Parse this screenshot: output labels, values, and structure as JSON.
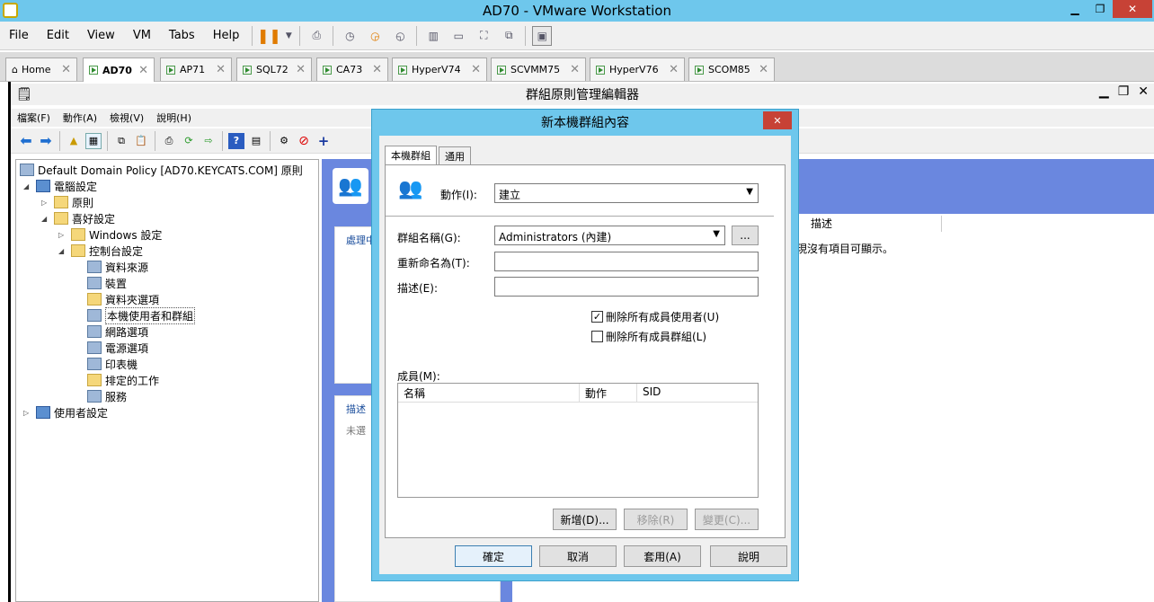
{
  "vmware": {
    "title": "AD70 - VMware Workstation",
    "menu": [
      "File",
      "Edit",
      "View",
      "VM",
      "Tabs",
      "Help"
    ],
    "tabs": [
      {
        "label": "Home",
        "active": false
      },
      {
        "label": "AD70",
        "active": true
      },
      {
        "label": "AP71",
        "active": false
      },
      {
        "label": "SQL72",
        "active": false
      },
      {
        "label": "CA73",
        "active": false
      },
      {
        "label": "HyperV74",
        "active": false
      },
      {
        "label": "SCVMM75",
        "active": false
      },
      {
        "label": "HyperV76",
        "active": false
      },
      {
        "label": "SCOM85",
        "active": false
      }
    ]
  },
  "gpme": {
    "title": "群組原則管理編輯器",
    "menu": [
      "檔案(F)",
      "動作(A)",
      "檢視(V)",
      "說明(H)"
    ],
    "tree": {
      "root": "Default Domain Policy [AD70.KEYCATS.COM] 原則",
      "computer": "電腦設定",
      "policies": "原則",
      "preferences": "喜好設定",
      "windows_settings": "Windows 設定",
      "control_panel": "控制台設定",
      "items": [
        "資料來源",
        "裝置",
        "資料夾選項",
        "本機使用者和群組",
        "網路選項",
        "電源選項",
        "印表機",
        "排定的工作",
        "服務"
      ],
      "user": "使用者設定"
    },
    "right": {
      "col_desc": "描述",
      "empty_text": "現沒有項目可顯示。",
      "tab_process": "處理中",
      "tab_desc": "描述",
      "unselected": "未選"
    }
  },
  "dialog": {
    "title": "新本機群組內容",
    "tabs": [
      "本機群組",
      "通用"
    ],
    "action_label": "動作(I):",
    "action_value": "建立",
    "group_label": "群組名稱(G):",
    "group_value": "Administrators (內建)",
    "browse": "...",
    "rename_label": "重新命名為(T):",
    "desc_label": "描述(E):",
    "chk_users": "刪除所有成員使用者(U)",
    "chk_users_checked": true,
    "chk_groups": "刪除所有成員群組(L)",
    "chk_groups_checked": false,
    "members_label": "成員(M):",
    "cols": [
      "名稱",
      "動作",
      "SID"
    ],
    "add": "新增(D)...",
    "remove": "移除(R)",
    "change": "變更(C)...",
    "ok": "確定",
    "cancel": "取消",
    "apply": "套用(A)",
    "help": "說明"
  }
}
